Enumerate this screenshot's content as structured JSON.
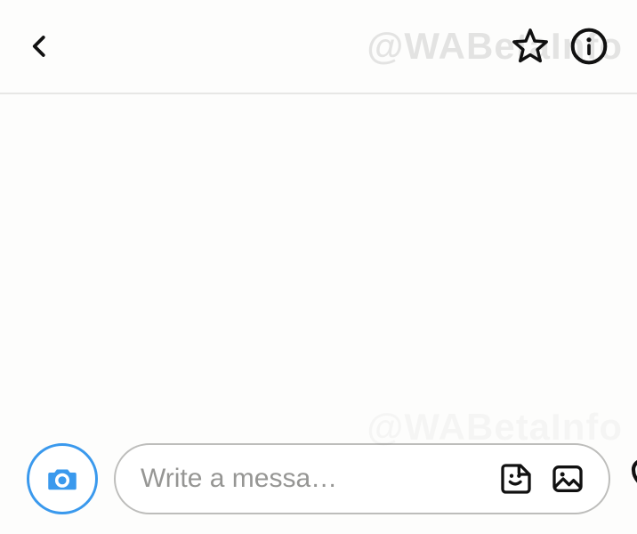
{
  "watermark": "@WABetaInfo",
  "composer": {
    "placeholder": "Write a messa…"
  }
}
